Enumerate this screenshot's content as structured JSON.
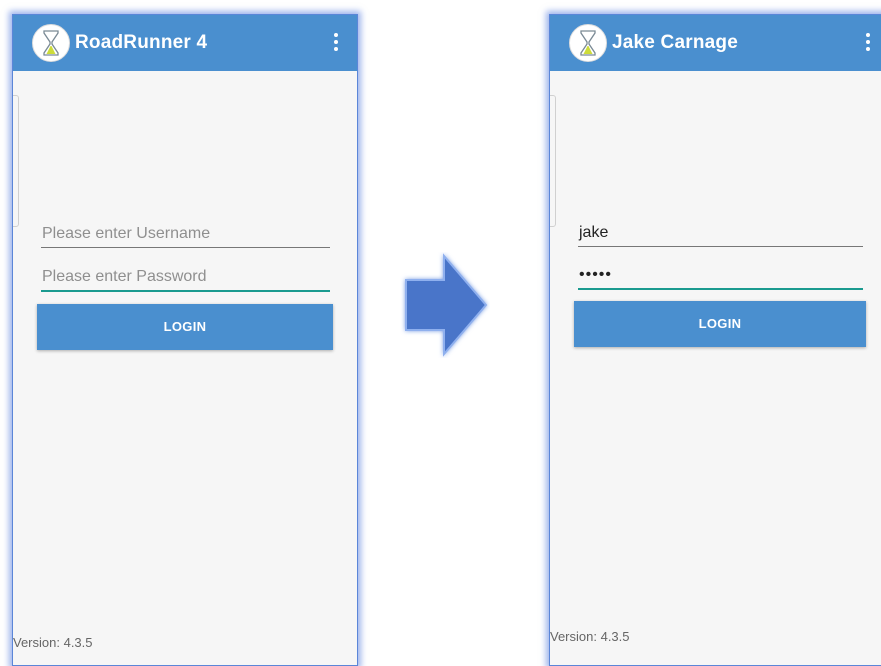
{
  "left_screen": {
    "title": "RoadRunner 4",
    "username_placeholder": "Please enter Username",
    "password_placeholder": "Please enter Password",
    "login_label": "LOGIN",
    "version": "Version: 4.3.5"
  },
  "right_screen": {
    "title": "Jake Carnage",
    "username_value": "jake",
    "password_value": "•••••",
    "login_label": "LOGIN",
    "version": "Version: 4.3.5"
  },
  "icons": {
    "logo": "hourglass-logo-icon",
    "menu": "overflow-menu-icon",
    "arrow": "arrow-right-icon"
  },
  "colors": {
    "app_bar": "#4a8fcf",
    "accent_underline": "#1a9a8f",
    "arrow": "#4a74c9"
  }
}
